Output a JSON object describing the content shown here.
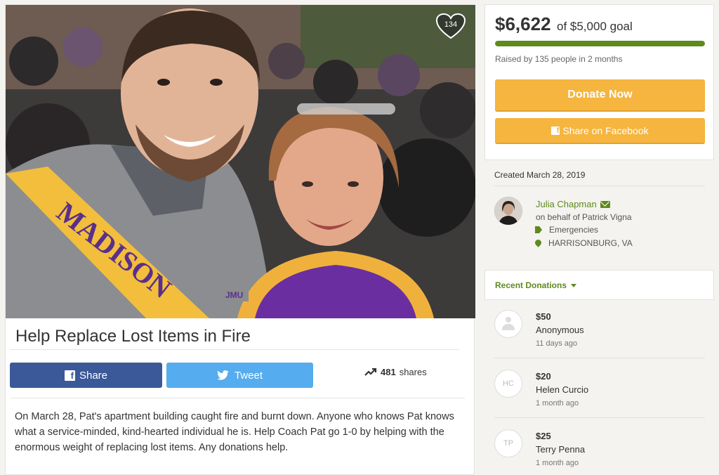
{
  "hero": {
    "heart_count": "134",
    "sash_text": "MADISON"
  },
  "campaign": {
    "title": "Help Replace Lost Items in Fire",
    "story": "On March 28, Pat's apartment building caught fire and burnt down. Anyone who knows Pat knows what a service-minded, kind-hearted individual he is. Help Coach Pat go 1-0 by helping with the enormous weight of replacing lost items. Any donations help."
  },
  "share_bar": {
    "facebook_label": "Share",
    "twitter_label": "Tweet",
    "shares_count": "481",
    "shares_label": "shares"
  },
  "funding": {
    "amount": "$6,622",
    "goal_text": "of $5,000 goal",
    "progress_fraction": 1.0,
    "raised_text": "Raised by 135 people in 2 months",
    "donate_label": "Donate Now",
    "share_facebook_label": "Share on Facebook"
  },
  "meta": {
    "created": "Created March 28, 2019",
    "organizer_name": "Julia Chapman",
    "behalf": "on behalf of Patrick Vigna",
    "category": "Emergencies",
    "location": "HARRISONBURG, VA"
  },
  "recent": {
    "label": "Recent Donations",
    "donations": [
      {
        "amount": "$50",
        "name": "Anonymous",
        "time": "11 days ago",
        "initials": ""
      },
      {
        "amount": "$20",
        "name": "Helen Curcio",
        "time": "1 month ago",
        "initials": "HC"
      },
      {
        "amount": "$25",
        "name": "Terry Penna",
        "time": "1 month ago",
        "initials": "TP"
      }
    ]
  },
  "colors": {
    "accent_green": "#5f8a1e",
    "donate_orange": "#f5b53f",
    "facebook_blue": "#3b5998",
    "twitter_blue": "#55acee"
  },
  "icons": [
    "heart-icon",
    "facebook-icon",
    "twitter-icon",
    "trending-icon",
    "mail-icon",
    "tag-icon",
    "location-pin-icon",
    "caret-down-icon",
    "user-icon"
  ]
}
